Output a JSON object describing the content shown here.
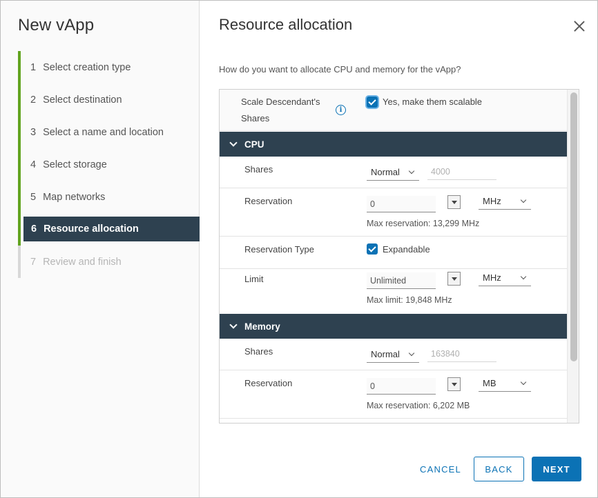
{
  "wizard": {
    "title": "New vApp",
    "steps": [
      {
        "num": "1",
        "label": "Select creation type"
      },
      {
        "num": "2",
        "label": "Select destination"
      },
      {
        "num": "3",
        "label": "Select a name and location"
      },
      {
        "num": "4",
        "label": "Select storage"
      },
      {
        "num": "5",
        "label": "Map networks"
      },
      {
        "num": "6",
        "label": "Resource allocation"
      },
      {
        "num": "7",
        "label": "Review and finish"
      }
    ]
  },
  "page": {
    "title": "Resource allocation",
    "question": "How do you want to allocate CPU and memory for the vApp?"
  },
  "scale": {
    "label_line1": "Scale Descendant's",
    "label_line2": "Shares",
    "checkbox_label": "Yes, make them scalable"
  },
  "cpu": {
    "section_label": "CPU",
    "shares_label": "Shares",
    "shares_level": "Normal",
    "shares_value": "4000",
    "reservation_label": "Reservation",
    "reservation_value": "0",
    "reservation_unit": "MHz",
    "max_reservation": "Max reservation: 13,299 MHz",
    "reservation_type_label": "Reservation Type",
    "expandable_label": "Expandable",
    "limit_label": "Limit",
    "limit_value": "Unlimited",
    "limit_unit": "MHz",
    "max_limit": "Max limit: 19,848 MHz"
  },
  "memory": {
    "section_label": "Memory",
    "shares_label": "Shares",
    "shares_level": "Normal",
    "shares_value": "163840",
    "reservation_label": "Reservation",
    "reservation_value": "0",
    "reservation_unit": "MB",
    "max_reservation": "Max reservation: 6,202 MB"
  },
  "footer": {
    "cancel": "CANCEL",
    "back": "BACK",
    "next": "NEXT"
  },
  "colors": {
    "accent": "#0b72b5",
    "nav_active": "#2e4150",
    "step_done": "#62a420"
  }
}
